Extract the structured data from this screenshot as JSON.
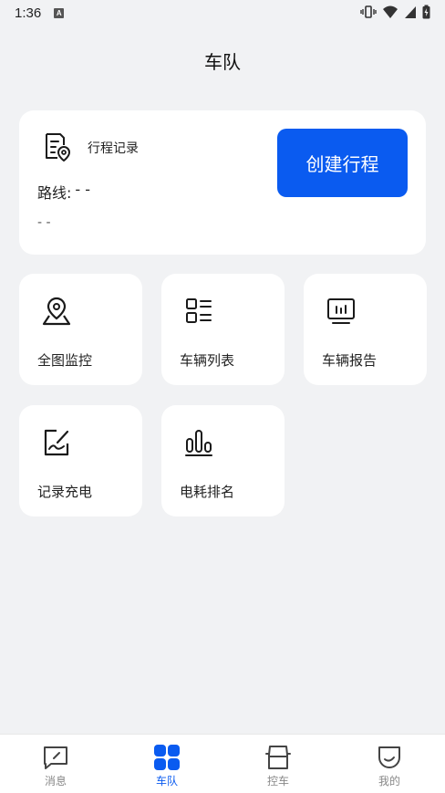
{
  "status_bar": {
    "time": "1:36",
    "notification_badge": "A"
  },
  "header": {
    "title": "车队"
  },
  "trip_card": {
    "title": "行程记录",
    "route_label": "路线:",
    "route_value": "- -",
    "sub_value": "- -",
    "create_button_label": "创建行程"
  },
  "tiles": [
    {
      "label": "全图监控",
      "icon": "map-pin-icon"
    },
    {
      "label": "车辆列表",
      "icon": "list-icon"
    },
    {
      "label": "车辆报告",
      "icon": "report-monitor-icon"
    },
    {
      "label": "记录充电",
      "icon": "edit-chart-icon"
    },
    {
      "label": "电耗排名",
      "icon": "bar-chart-icon"
    }
  ],
  "bottom_nav": {
    "items": [
      {
        "label": "消息",
        "icon": "message-icon",
        "active": false
      },
      {
        "label": "车队",
        "icon": "grid-icon",
        "active": true
      },
      {
        "label": "控车",
        "icon": "car-icon",
        "active": false
      },
      {
        "label": "我的",
        "icon": "smile-icon",
        "active": false
      }
    ]
  },
  "colors": {
    "accent": "#0a5bf0",
    "background": "#f1f2f4",
    "card": "#ffffff"
  }
}
